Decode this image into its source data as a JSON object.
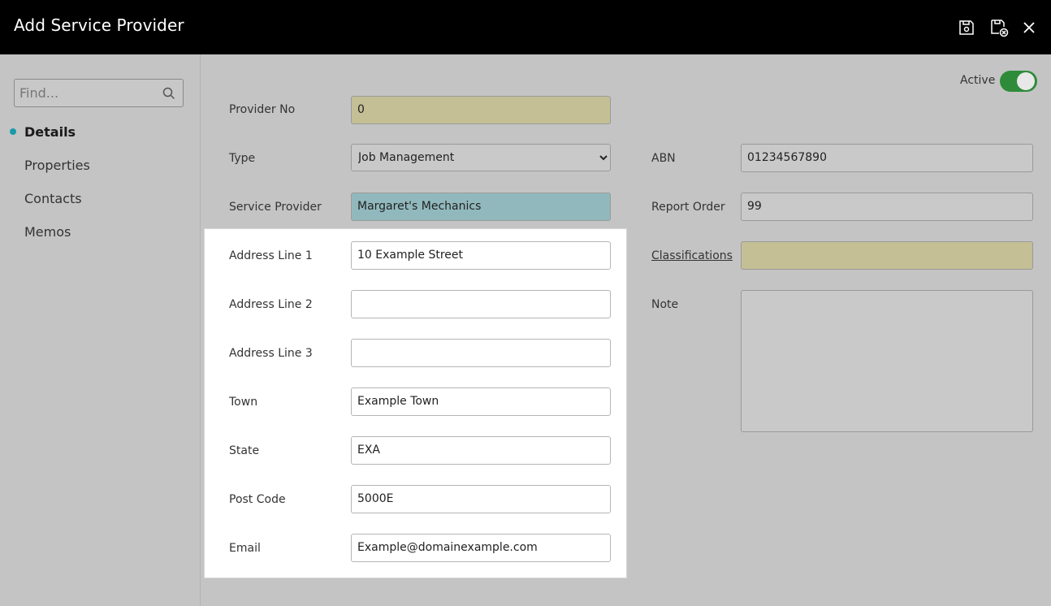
{
  "header": {
    "title": "Add Service Provider"
  },
  "sidebar": {
    "find_placeholder": "Find...",
    "items": [
      {
        "label": "Details"
      },
      {
        "label": "Properties"
      },
      {
        "label": "Contacts"
      },
      {
        "label": "Memos"
      }
    ]
  },
  "status": {
    "active_label": "Active",
    "active_on": true
  },
  "form": {
    "provider_no": {
      "label": "Provider No",
      "value": "0"
    },
    "type": {
      "label": "Type",
      "value": "Job Management"
    },
    "service_provider": {
      "label": "Service Provider",
      "value": "Margaret's Mechanics"
    },
    "abn": {
      "label": "ABN",
      "value": "01234567890"
    },
    "report_order": {
      "label": "Report Order",
      "value": "99"
    },
    "classifications": {
      "label": "Classifications",
      "value": ""
    },
    "note": {
      "label": "Note",
      "value": ""
    },
    "address": {
      "line1": {
        "label": "Address Line 1",
        "value": "10 Example Street"
      },
      "line2": {
        "label": "Address Line 2",
        "value": ""
      },
      "line3": {
        "label": "Address Line 3",
        "value": ""
      },
      "town": {
        "label": "Town",
        "value": "Example Town"
      },
      "state": {
        "label": "State",
        "value": "EXA"
      },
      "post_code": {
        "label": "Post Code",
        "value": "5000E"
      },
      "email": {
        "label": "Email",
        "value": "Example@domainexample.com"
      }
    }
  },
  "colors": {
    "toggle_on": "#2e8b3a",
    "accent_dot": "#1a9ba8",
    "required_field": "#c4bf95",
    "highlight_field": "#91b9bd"
  },
  "icons": [
    "save-icon",
    "save-and-close-icon",
    "close-icon",
    "search-icon"
  ]
}
